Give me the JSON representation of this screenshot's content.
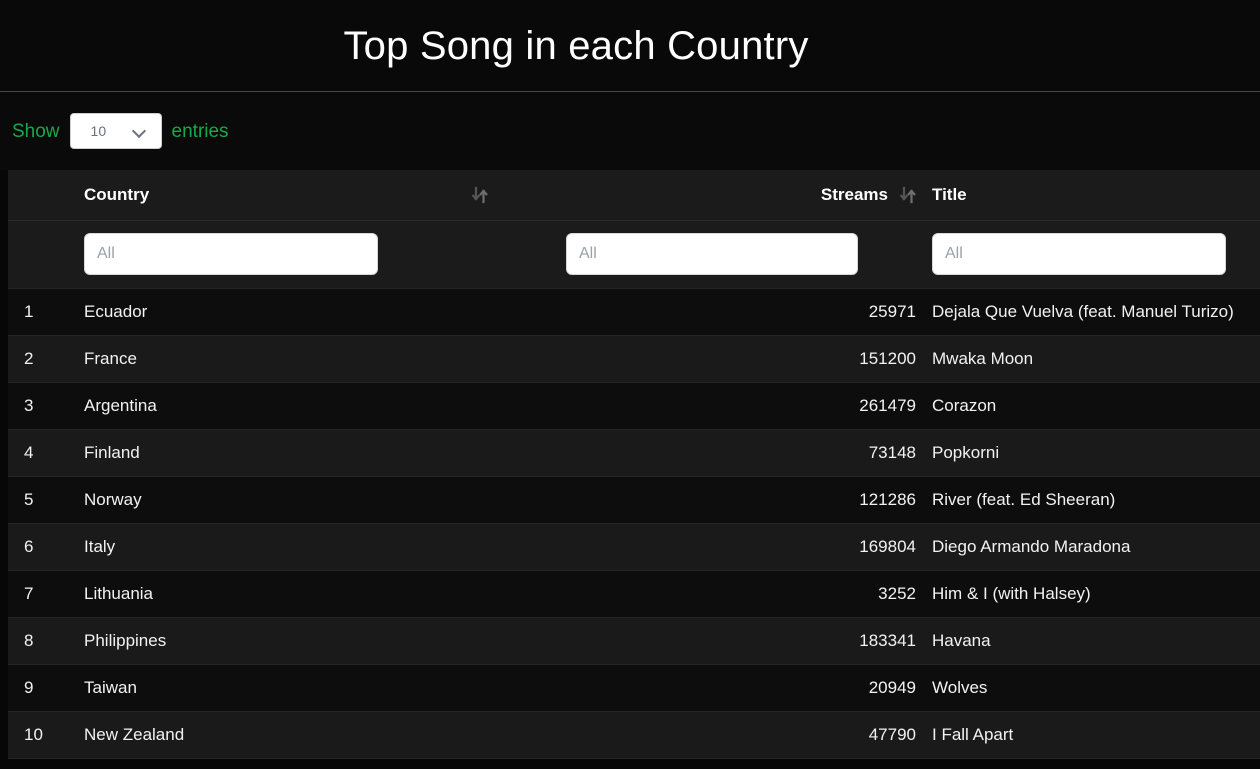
{
  "header": {
    "title": "Top Song in each Country"
  },
  "controls": {
    "show_label": "Show",
    "entries_label": "entries",
    "page_length_value": "10",
    "chevron_icon": "chevron-down-icon"
  },
  "table": {
    "columns": [
      {
        "key": "index",
        "label": "",
        "sortable": false,
        "align": "left"
      },
      {
        "key": "country",
        "label": "Country",
        "sortable": true,
        "align": "left",
        "sort_icon": "sort-updown-icon"
      },
      {
        "key": "streams",
        "label": "Streams",
        "sortable": true,
        "align": "right",
        "sort_icon": "sort-updown-icon"
      },
      {
        "key": "title",
        "label": "Title",
        "sortable": false,
        "align": "left"
      }
    ],
    "filters": {
      "country_placeholder": "All",
      "country_value": "",
      "streams_placeholder": "All",
      "streams_value": "",
      "title_placeholder": "All",
      "title_value": ""
    },
    "rows": [
      {
        "index": "1",
        "country": "Ecuador",
        "streams": "25971",
        "title": "Dejala Que Vuelva (feat. Manuel Turizo)"
      },
      {
        "index": "2",
        "country": "France",
        "streams": "151200",
        "title": "Mwaka Moon"
      },
      {
        "index": "3",
        "country": "Argentina",
        "streams": "261479",
        "title": "Corazon"
      },
      {
        "index": "4",
        "country": "Finland",
        "streams": "73148",
        "title": "Popkorni"
      },
      {
        "index": "5",
        "country": "Norway",
        "streams": "121286",
        "title": "River (feat. Ed Sheeran)"
      },
      {
        "index": "6",
        "country": "Italy",
        "streams": "169804",
        "title": "Diego Armando Maradona"
      },
      {
        "index": "7",
        "country": "Lithuania",
        "streams": "3252",
        "title": "Him & I (with Halsey)"
      },
      {
        "index": "8",
        "country": "Philippines",
        "streams": "183341",
        "title": "Havana"
      },
      {
        "index": "9",
        "country": "Taiwan",
        "streams": "20949",
        "title": "Wolves"
      },
      {
        "index": "10",
        "country": "New Zealand",
        "streams": "47790",
        "title": "I Fall Apart"
      }
    ]
  },
  "colors": {
    "page_background": "#070707",
    "accent_green": "#17a948",
    "header_row_background": "#1b1b1b",
    "row_odd_background": "#0d0d0d",
    "row_even_background": "#1a1a1a",
    "text_primary": "#ffffff",
    "input_background": "#ffffff",
    "placeholder_text": "#9aa1a9"
  }
}
